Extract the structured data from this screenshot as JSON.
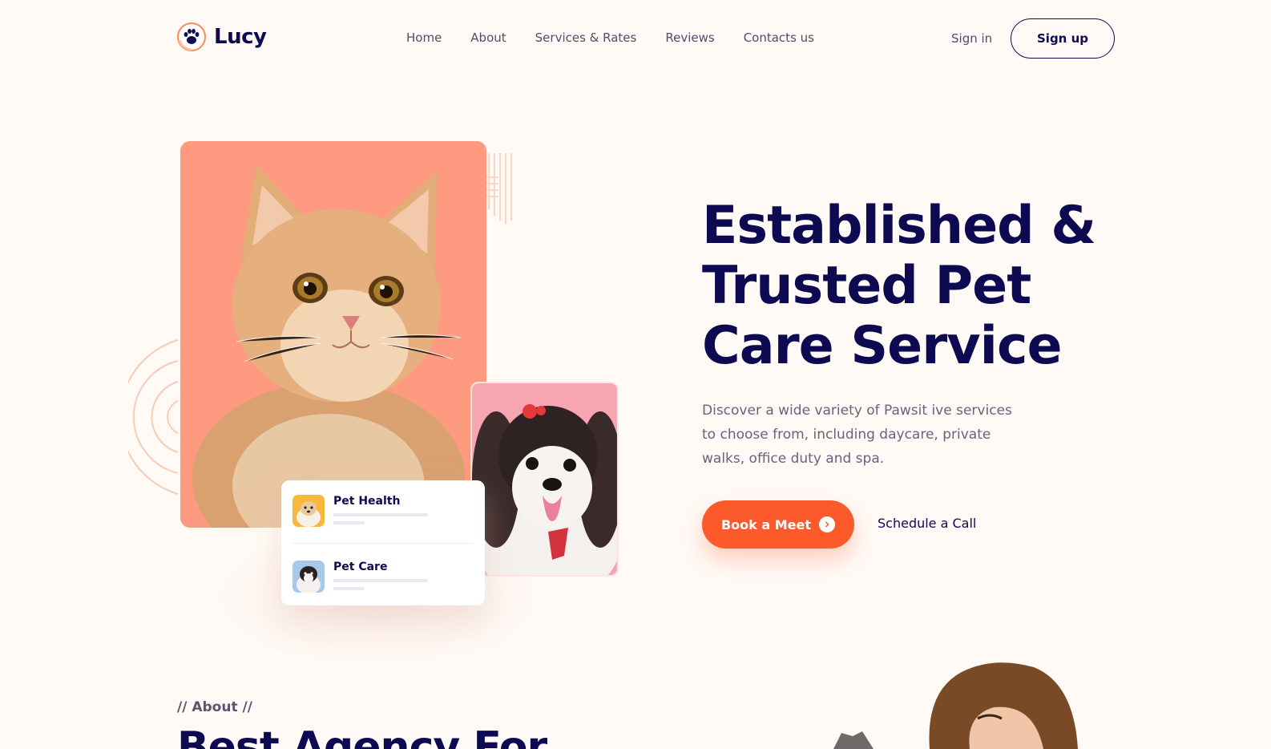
{
  "brand": {
    "name": "Lucy",
    "logo_icon": "paw-icon",
    "accent": "#fd5a2c",
    "navy": "#0d0a52"
  },
  "nav": {
    "items": [
      {
        "label": "Home"
      },
      {
        "label": "About"
      },
      {
        "label": "Services & Rates"
      },
      {
        "label": "Reviews"
      },
      {
        "label": "Contacts us"
      }
    ]
  },
  "auth": {
    "sign_in": "Sign in",
    "sign_up": "Sign up"
  },
  "hero": {
    "title_line1": "Established &",
    "title_line2": "Trusted Pet",
    "title_line3": "Care Service",
    "description": "Discover a wide variety of Pawsit ive services to choose from, including daycare, private walks, office duty and spa.",
    "primary_cta": "Book a Meet",
    "primary_cta_icon": "arrow-right-icon",
    "secondary_cta": "Schedule a Call"
  },
  "service_card": {
    "items": [
      {
        "title": "Pet Health"
      },
      {
        "title": "Pet Care"
      }
    ]
  },
  "about": {
    "label": "// About //",
    "title": "Best Agency For"
  }
}
